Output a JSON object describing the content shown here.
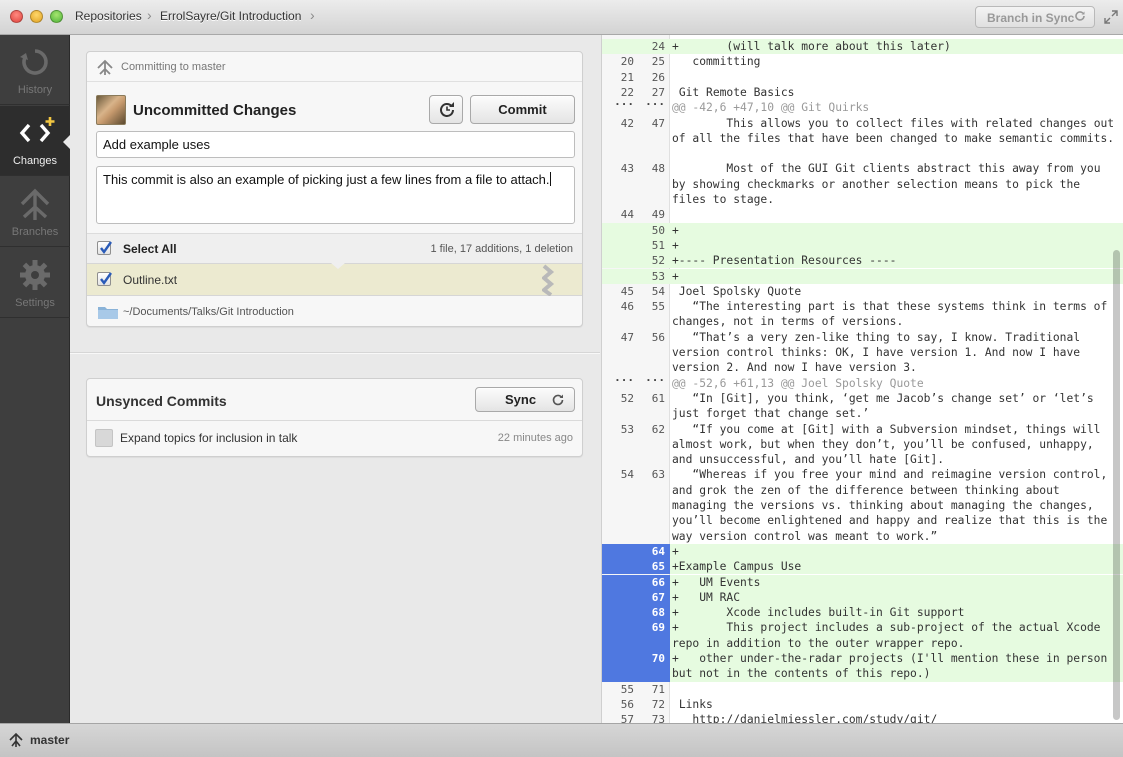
{
  "titlebar": {
    "breadcrumbs": [
      "Repositories",
      "ErrolSayre/Git Introduction"
    ],
    "sync_status": "Branch in Sync"
  },
  "sidebar": {
    "items": [
      {
        "label": "History",
        "icon": "history-icon"
      },
      {
        "label": "Changes",
        "icon": "changes-icon",
        "active": true
      },
      {
        "label": "Branches",
        "icon": "branches-icon"
      },
      {
        "label": "Settings",
        "icon": "settings-icon"
      }
    ]
  },
  "commit_panel": {
    "committing_to": "Committing to master",
    "title": "Uncommitted Changes",
    "commit_button": "Commit",
    "summary": "Add example uses",
    "description": "This commit is also an example of picking just a few lines from a file to attach.",
    "select_all_label": "Select All",
    "select_all_checked": true,
    "stats": "1 file, 17 additions, 1 deletion",
    "files": [
      {
        "name": "Outline.txt",
        "checked": true
      }
    ],
    "path": "~/Documents/Talks/Git Introduction"
  },
  "unsynced": {
    "title": "Unsynced Commits",
    "sync_button": "Sync",
    "commits": [
      {
        "message": "Expand topics for inclusion in talk",
        "time": "22 minutes ago"
      }
    ]
  },
  "diff": {
    "lines": [
      {
        "old": "",
        "new": "24",
        "text": "+       (will talk more about this later)",
        "type": "add"
      },
      {
        "old": "20",
        "new": "25",
        "text": "   committing",
        "type": "ctx"
      },
      {
        "old": "21",
        "new": "26",
        "text": "",
        "type": "ctx"
      },
      {
        "old": "22",
        "new": "27",
        "text": " Git Remote Basics",
        "type": "ctx"
      },
      {
        "old": "...",
        "new": "...",
        "text": "@@ -42,6 +47,10 @@ Git Quirks",
        "type": "hunk"
      },
      {
        "old": "42",
        "new": "47",
        "text": "        This allows you to collect files with related changes out of all the files that have been changed to make semantic commits.",
        "type": "ctx"
      },
      {
        "old": "43",
        "new": "48",
        "text": "        Most of the GUI Git clients abstract this away from you by showing checkmarks or another selection means to pick the files to stage.",
        "type": "ctx"
      },
      {
        "old": "44",
        "new": "49",
        "text": "",
        "type": "ctx"
      },
      {
        "old": "",
        "new": "50",
        "text": "+",
        "type": "add"
      },
      {
        "old": "",
        "new": "51",
        "text": "+",
        "type": "add"
      },
      {
        "old": "",
        "new": "52",
        "text": "+---- Presentation Resources ----",
        "type": "add"
      },
      {
        "old": "",
        "new": "53",
        "text": "+",
        "type": "add"
      },
      {
        "old": "45",
        "new": "54",
        "text": " Joel Spolsky Quote",
        "type": "ctx"
      },
      {
        "old": "46",
        "new": "55",
        "text": "   “The interesting part is that these systems think in terms of changes, not in terms of versions.",
        "type": "ctx"
      },
      {
        "old": "47",
        "new": "56",
        "text": "   “That’s a very zen-like thing to say, I know. Traditional version control thinks: OK, I have version 1. And now I have version 2. And now I have version 3.",
        "type": "ctx"
      },
      {
        "old": "...",
        "new": "...",
        "text": "@@ -52,6 +61,13 @@ Joel Spolsky Quote",
        "type": "hunk"
      },
      {
        "old": "52",
        "new": "61",
        "text": "   “In [Git], you think, ‘get me Jacob’s change set’ or ‘let’s just forget that change set.’",
        "type": "ctx"
      },
      {
        "old": "53",
        "new": "62",
        "text": "   “If you come at [Git] with a Subversion mindset, things will almost work, but when they don’t, you’ll be confused, unhappy, and unsuccessful, and you’ll hate [Git].",
        "type": "ctx"
      },
      {
        "old": "54",
        "new": "63",
        "text": "   “Whereas if you free your mind and reimagine version control, and grok the zen of the difference between thinking about managing the versions vs. thinking about managing the changes, you’ll become enlightened and happy and realize that this is the way version control was meant to work.”",
        "type": "ctx"
      },
      {
        "old": "",
        "new": "64",
        "text": "+",
        "type": "add",
        "selected": true
      },
      {
        "old": "",
        "new": "65",
        "text": "+Example Campus Use",
        "type": "add",
        "selected": true
      },
      {
        "old": "",
        "new": "66",
        "text": "+   UM Events",
        "type": "add",
        "selected": true
      },
      {
        "old": "",
        "new": "67",
        "text": "+   UM RAC",
        "type": "add",
        "selected": true
      },
      {
        "old": "",
        "new": "68",
        "text": "+       Xcode includes built-in Git support",
        "type": "add",
        "selected": true
      },
      {
        "old": "",
        "new": "69",
        "text": "+       This project includes a sub-project of the actual Xcode repo in addition to the outer wrapper repo.",
        "type": "add",
        "selected": true
      },
      {
        "old": "",
        "new": "70",
        "text": "+   other under-the-radar projects (I'll mention these in person but not in the contents of this repo.)",
        "type": "add",
        "selected": true
      },
      {
        "old": "55",
        "new": "71",
        "text": "",
        "type": "ctx"
      },
      {
        "old": "56",
        "new": "72",
        "text": " Links",
        "type": "ctx"
      },
      {
        "old": "57",
        "new": "73",
        "text": "   http://danielmiessler.com/study/git/",
        "type": "ctx"
      }
    ]
  },
  "statusbar": {
    "branch": "master"
  },
  "colors": {
    "selection": "#4f78e0",
    "addition_bg": "#e6fbe0",
    "sidebar_bg": "#3e3e3e",
    "file_highlight": "#ecead0"
  }
}
